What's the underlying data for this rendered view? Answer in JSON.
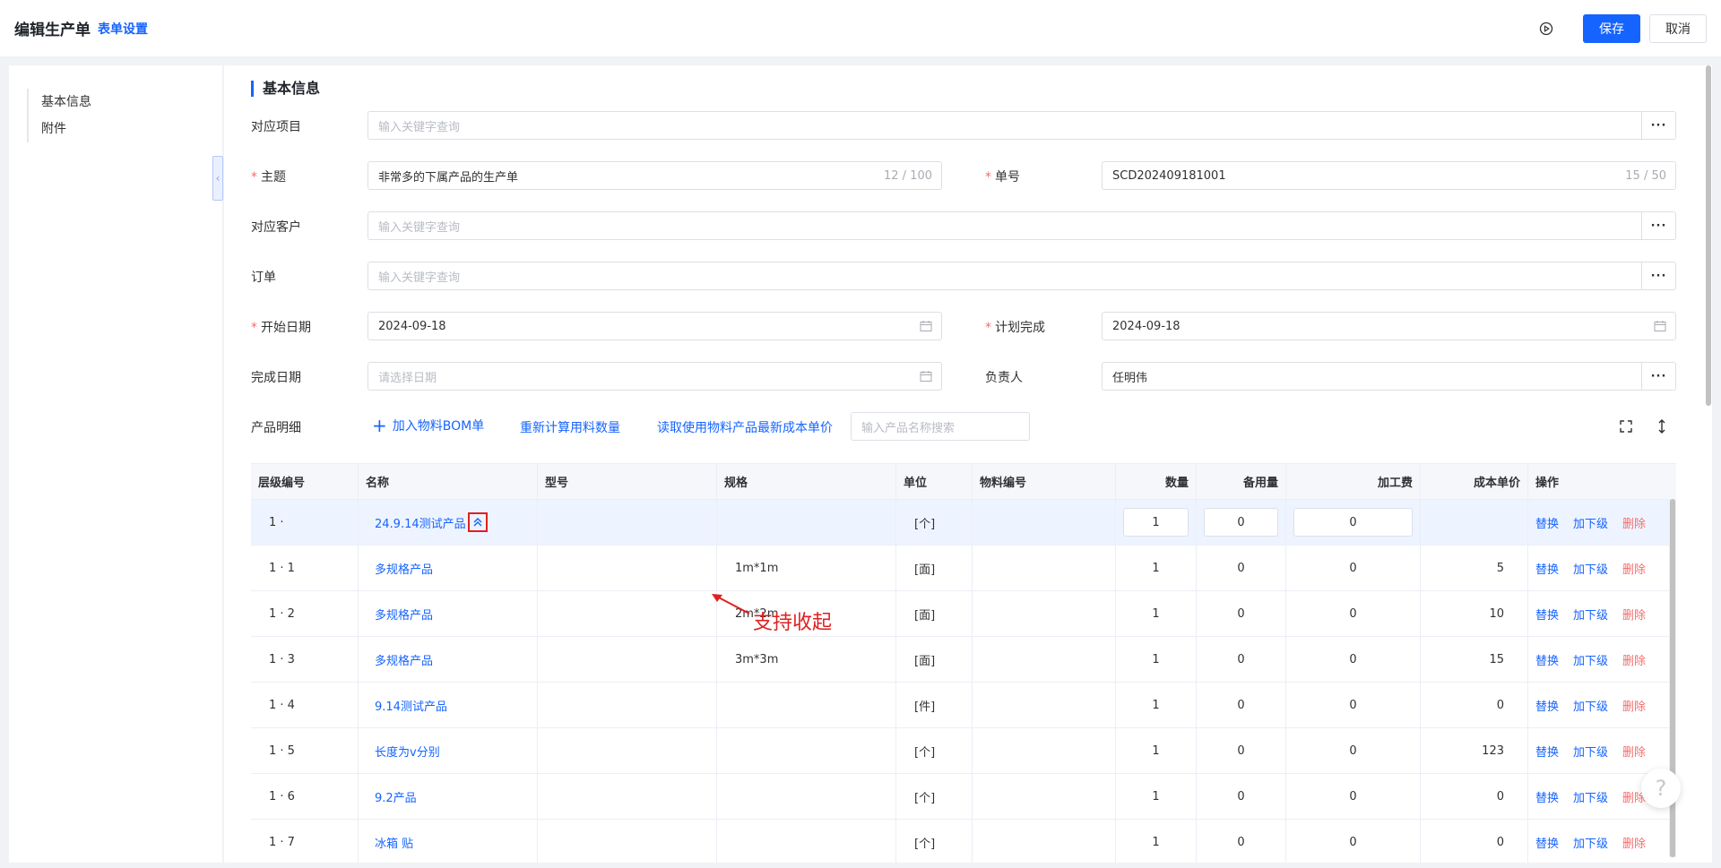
{
  "header": {
    "title": "编辑生产单",
    "form_settings": "表单设置",
    "save": "保存",
    "cancel": "取消"
  },
  "sidebar": {
    "items": [
      "基本信息",
      "附件"
    ]
  },
  "section": {
    "title": "基本信息"
  },
  "form": {
    "project": {
      "label": "对应项目",
      "placeholder": "输入关键字查询"
    },
    "subject": {
      "label": "主题",
      "value": "非常多的下属产品的生产单",
      "count": "12 / 100"
    },
    "order_no": {
      "label": "单号",
      "value": "SCD202409181001",
      "count": "15 / 50"
    },
    "customer": {
      "label": "对应客户",
      "placeholder": "输入关键字查询"
    },
    "order": {
      "label": "订单",
      "placeholder": "输入关键字查询"
    },
    "start_date": {
      "label": "开始日期",
      "value": "2024-09-18"
    },
    "plan_done": {
      "label": "计划完成",
      "value": "2024-09-18"
    },
    "finish_date": {
      "label": "完成日期",
      "placeholder": "请选择日期"
    },
    "owner": {
      "label": "负责人",
      "value": "任明伟"
    }
  },
  "products": {
    "label": "产品明细",
    "add_bom": "加入物料BOM单",
    "recalc": "重新计算用料数量",
    "read_cost": "读取使用物料产品最新成本单价",
    "search_placeholder": "输入产品名称搜索"
  },
  "table": {
    "columns": [
      "层级编号",
      "名称",
      "型号",
      "规格",
      "单位",
      "物料编号",
      "数量",
      "备用量",
      "加工费",
      "成本单价",
      "操作"
    ],
    "actions": {
      "replace": "替换",
      "add_sub": "加下级",
      "delete": "删除"
    },
    "rows": [
      {
        "level": "1 ·",
        "name": "24.9.14测试产品",
        "model": "",
        "spec": "",
        "unit": "[个]",
        "code": "",
        "qty": "1",
        "spare": "0",
        "fee": "0",
        "cost": ""
      },
      {
        "level": "1 · 1",
        "name": "多规格产品",
        "model": "",
        "spec": "1m*1m",
        "unit": "[面]",
        "code": "",
        "qty": "1",
        "spare": "0",
        "fee": "0",
        "cost": "5"
      },
      {
        "level": "1 · 2",
        "name": "多规格产品",
        "model": "",
        "spec": "2m*2m",
        "unit": "[面]",
        "code": "",
        "qty": "1",
        "spare": "0",
        "fee": "0",
        "cost": "10"
      },
      {
        "level": "1 · 3",
        "name": "多规格产品",
        "model": "",
        "spec": "3m*3m",
        "unit": "[面]",
        "code": "",
        "qty": "1",
        "spare": "0",
        "fee": "0",
        "cost": "15"
      },
      {
        "level": "1 · 4",
        "name": "9.14测试产品",
        "model": "",
        "spec": "",
        "unit": "[件]",
        "code": "",
        "qty": "1",
        "spare": "0",
        "fee": "0",
        "cost": "0"
      },
      {
        "level": "1 · 5",
        "name": "长度为v分别",
        "model": "",
        "spec": "",
        "unit": "[个]",
        "code": "",
        "qty": "1",
        "spare": "0",
        "fee": "0",
        "cost": "123"
      },
      {
        "level": "1 · 6",
        "name": "9.2产品",
        "model": "",
        "spec": "",
        "unit": "[个]",
        "code": "",
        "qty": "1",
        "spare": "0",
        "fee": "0",
        "cost": "0"
      },
      {
        "level": "1 · 7",
        "name": "冰箱 贴",
        "model": "",
        "spec": "",
        "unit": "[个]",
        "code": "",
        "qty": "1",
        "spare": "0",
        "fee": "0",
        "cost": "0"
      }
    ]
  },
  "annotation": "支持收起",
  "icons": {
    "play": "play-circle-icon",
    "calendar": "calendar-icon",
    "fullscreen": "fullscreen-icon",
    "expand": "vertical-expand-icon",
    "collapse": "double-chevron-up-icon",
    "help": "help-icon"
  },
  "colors": {
    "primary": "#1664ff",
    "danger": "#f56c6c",
    "annotation": "#e02020"
  }
}
